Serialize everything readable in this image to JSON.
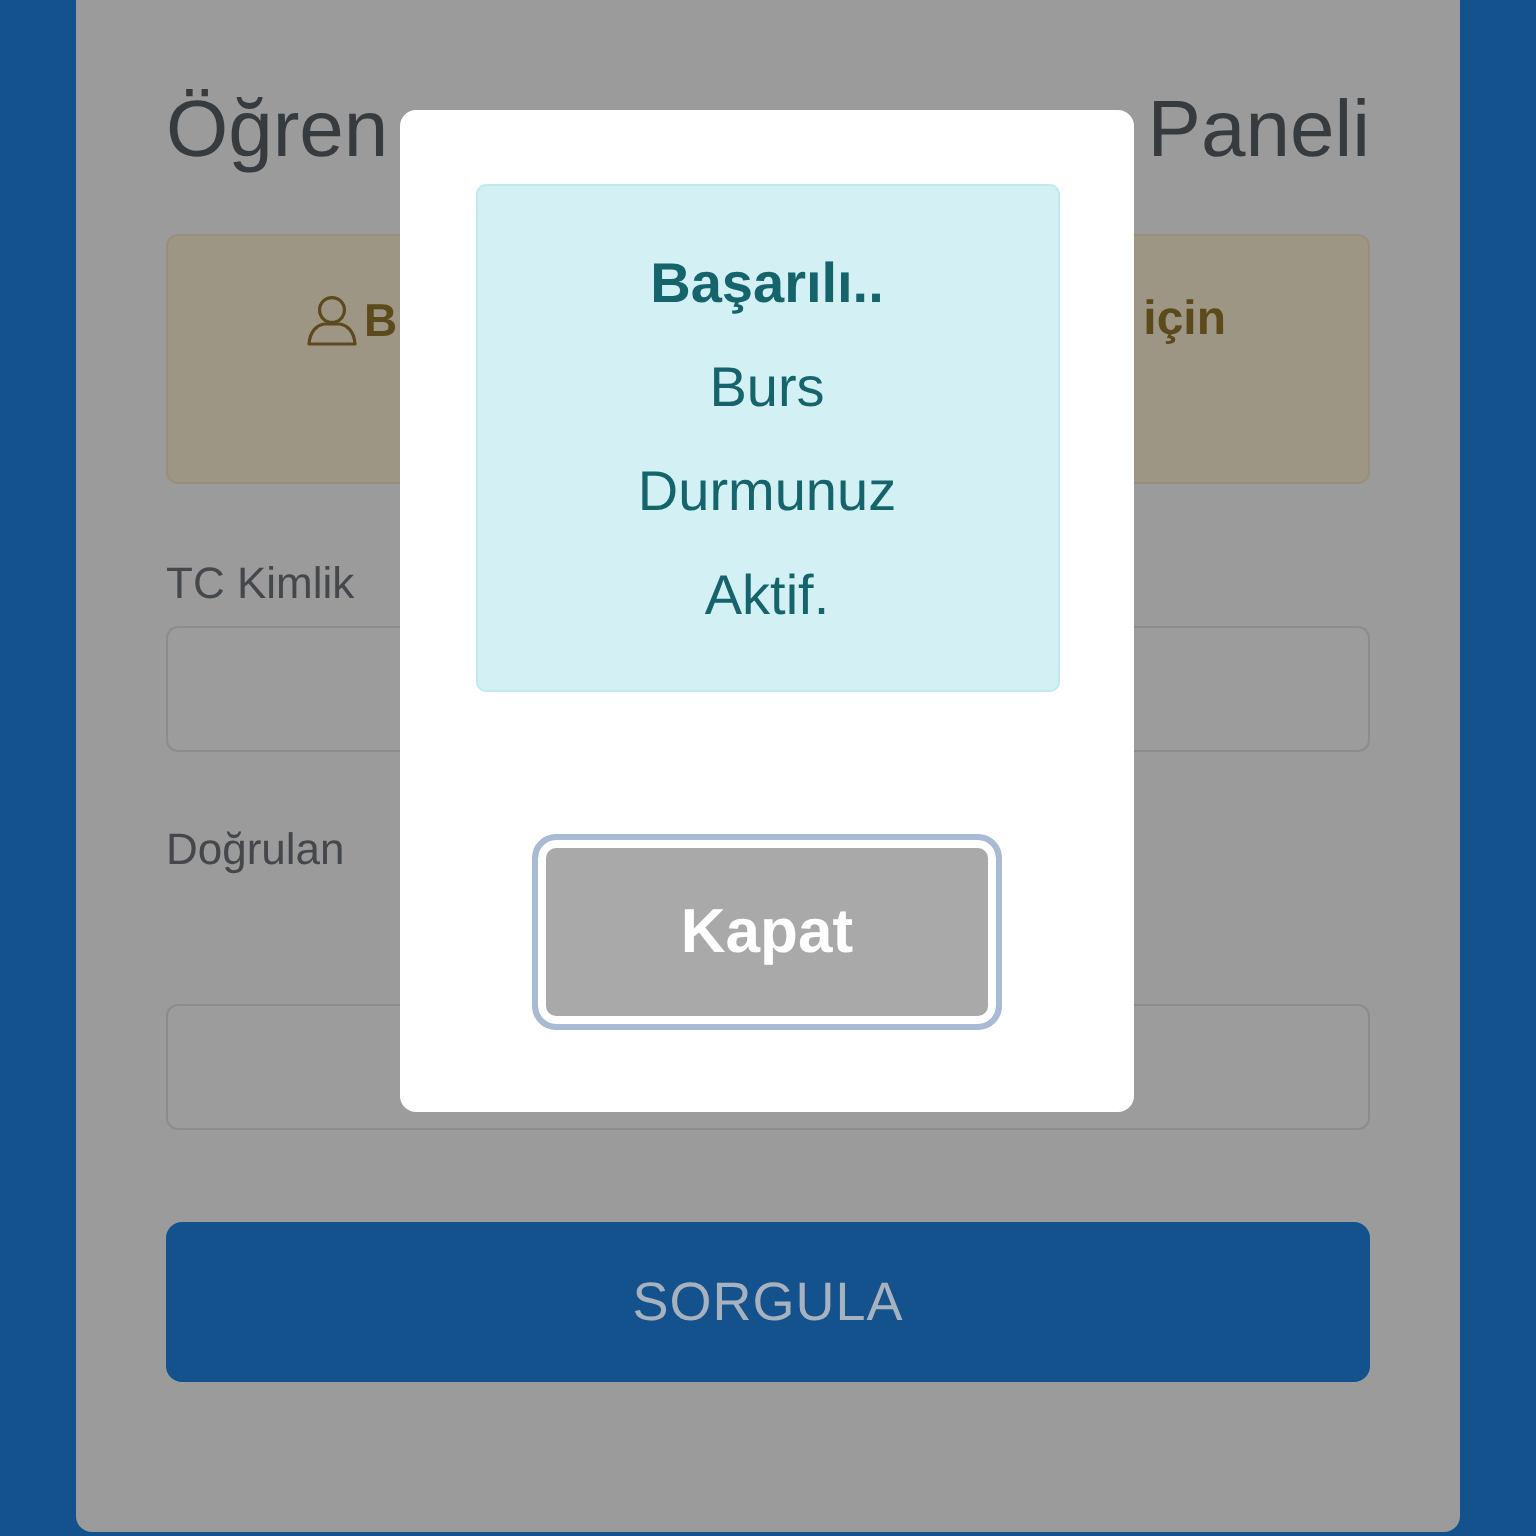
{
  "page": {
    "title_visible_parts": [
      "Öğren",
      "Paneli"
    ],
    "notice_visible_parts": [
      "B",
      "için"
    ],
    "fields": [
      {
        "label": "TC Kimlik"
      },
      {
        "label": "Doğrulan"
      }
    ],
    "submit_button": "SORGULA"
  },
  "modal": {
    "message": "**Başarılı..** Burs Durmunuz Aktif.",
    "close_button": {
      "label": "Kapat",
      "focused": true
    }
  }
}
